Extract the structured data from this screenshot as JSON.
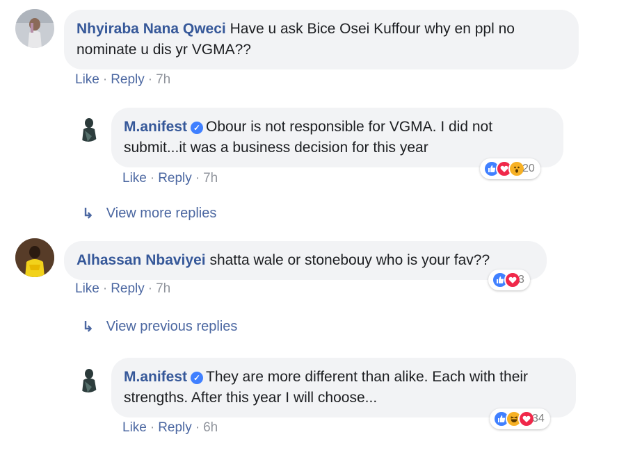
{
  "comments": [
    {
      "author": "Nhyiraba Nana Qweci",
      "text": "Have u ask Bice Osei Kuffour why en ppl no nominate u dis yr VGMA??",
      "like": "Like",
      "reply": "Reply",
      "time": "7h"
    },
    {
      "author": "M.anifest",
      "verified": "✓",
      "text": "Obour is not responsible for VGMA. I did not submit...it was a business decision for this year",
      "like": "Like",
      "reply": "Reply",
      "time": "7h",
      "reactions": [
        "like-icon",
        "love-icon",
        "wow-icon"
      ],
      "reaction_count": "20"
    },
    {
      "author": "Alhassan Nbaviyei",
      "text": "shatta wale or stonebouy who is your fav??",
      "like": "Like",
      "reply": "Reply",
      "time": "7h",
      "reactions": [
        "like-icon",
        "love-icon"
      ],
      "reaction_count": "3"
    },
    {
      "author": "M.anifest",
      "verified": "✓",
      "text": "They are more different than alike. Each with their strengths. After this year I will choose...",
      "like": "Like",
      "reply": "Reply",
      "time": "6h",
      "reactions": [
        "like-icon",
        "haha-icon",
        "love-icon"
      ],
      "reaction_count": "34"
    }
  ],
  "links": {
    "view_more_replies": "View more replies",
    "view_previous_replies": "View previous replies"
  },
  "separator": "·",
  "colors": {
    "author": "#365899",
    "bubble": "#f2f3f5",
    "like": "#4080ff",
    "love": "#f0284a",
    "wow": "#f7b125"
  }
}
